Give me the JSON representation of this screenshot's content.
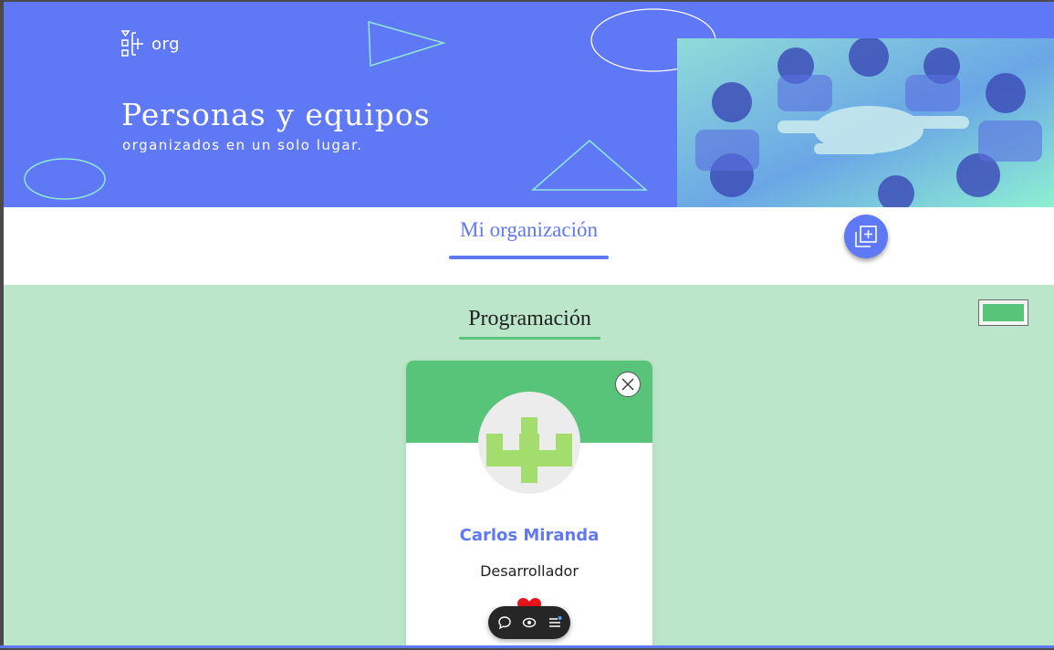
{
  "header": {
    "logo_text": "org",
    "title": "Personas y equipos",
    "subtitle": "organizados en un solo lugar.",
    "photo_icon": "team-hands-photo"
  },
  "tabs": [
    {
      "label": "Mi organización",
      "active": true
    }
  ],
  "actions": {
    "add_team_icon": "add-copy-icon"
  },
  "team": {
    "name": "Programación",
    "color": "#57c47a",
    "members": [
      {
        "name": "Carlos Miranda",
        "role": "Desarrollador",
        "avatar_color": "#a3dd6e",
        "liked": true
      }
    ]
  },
  "toolbar": {
    "icons": [
      "comment-icon",
      "eye-icon",
      "menu-icon"
    ]
  },
  "colors": {
    "brand_blue": "#5f78f5",
    "team_green": "#57c47a",
    "section_bg": "#bbe6c9",
    "heart_red": "#e8141b"
  }
}
